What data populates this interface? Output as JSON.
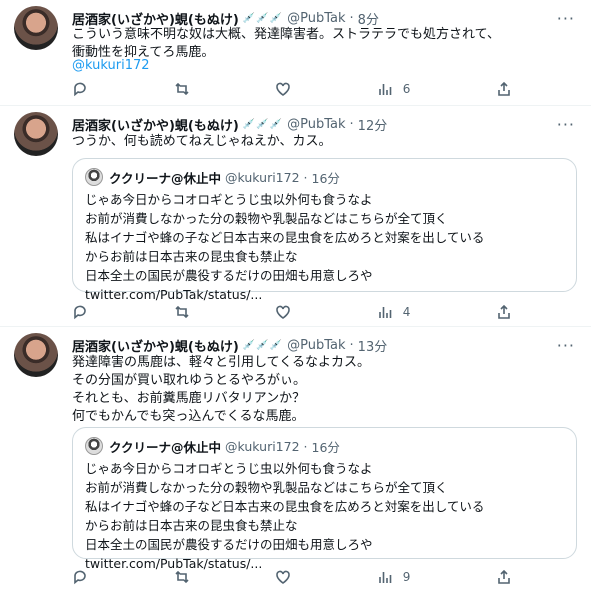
{
  "tweets": [
    {
      "name": "居酒家(いざかや)蜆(もぬけ)",
      "emoji": "💉💉💉",
      "handle": "@PubTak",
      "dot": "·",
      "time": "8分",
      "text": "こういう意味不明な奴は大概、発達障害者。ストラテラでも処方されて、\n衝動性を抑えてろ馬鹿。",
      "mention": "@kukuri172",
      "like_count": "6"
    },
    {
      "name": "居酒家(いざかや)蜆(もぬけ)",
      "emoji": "💉💉💉",
      "handle": "@PubTak",
      "dot": "·",
      "time": "12分",
      "text": "つうか、何も読めてねえじゃねえか、カス。",
      "like_count": "4",
      "quote": {
        "name": "ククリーナ@休止中",
        "handle": "@kukuri172",
        "dot": "·",
        "time": "16分",
        "text": "じゃあ今日からコオロギとうじ虫以外何も食うなよ\nお前が消費しなかった分の穀物や乳製品などはこちらが全て頂く\n私はイナゴや蜂の子など日本古来の昆虫食を広めろと対案を出している\nからお前は日本古来の昆虫食も禁止な\n日本全土の国民が農役するだけの田畑も用意しろや\ntwitter.com/PubTak/status/..."
      }
    },
    {
      "name": "居酒家(いざかや)蜆(もぬけ)",
      "emoji": "💉💉💉",
      "handle": "@PubTak",
      "dot": "·",
      "time": "13分",
      "text": "発達障害の馬鹿は、軽々と引用してくるなよカス。\nその分国が買い取れゆうとるやろがぃ。\nそれとも、お前糞馬鹿リバタリアンか？\n何でもかんでも突っ込んでくるな馬鹿。",
      "like_count": "9",
      "quote": {
        "name": "ククリーナ@休止中",
        "handle": "@kukuri172",
        "dot": "·",
        "time": "16分",
        "text": "じゃあ今日からコオロギとうじ虫以外何も食うなよ\nお前が消費しなかった分の穀物や乳製品などはこちらが全て頂く\n私はイナゴや蜂の子など日本古来の昆虫食を広めろと対案を出している\nからお前は日本古来の昆虫食も禁止な\n日本全土の国民が農役するだけの田畑も用意しろや\ntwitter.com/PubTak/status/..."
      }
    }
  ],
  "icons": [
    "reply-icon",
    "retweet-icon",
    "like-icon",
    "views-icon",
    "share-icon",
    "more-icon"
  ],
  "colors": {
    "link": "#1d9bf0",
    "muted": "#536471",
    "border": "#cfd9de"
  }
}
